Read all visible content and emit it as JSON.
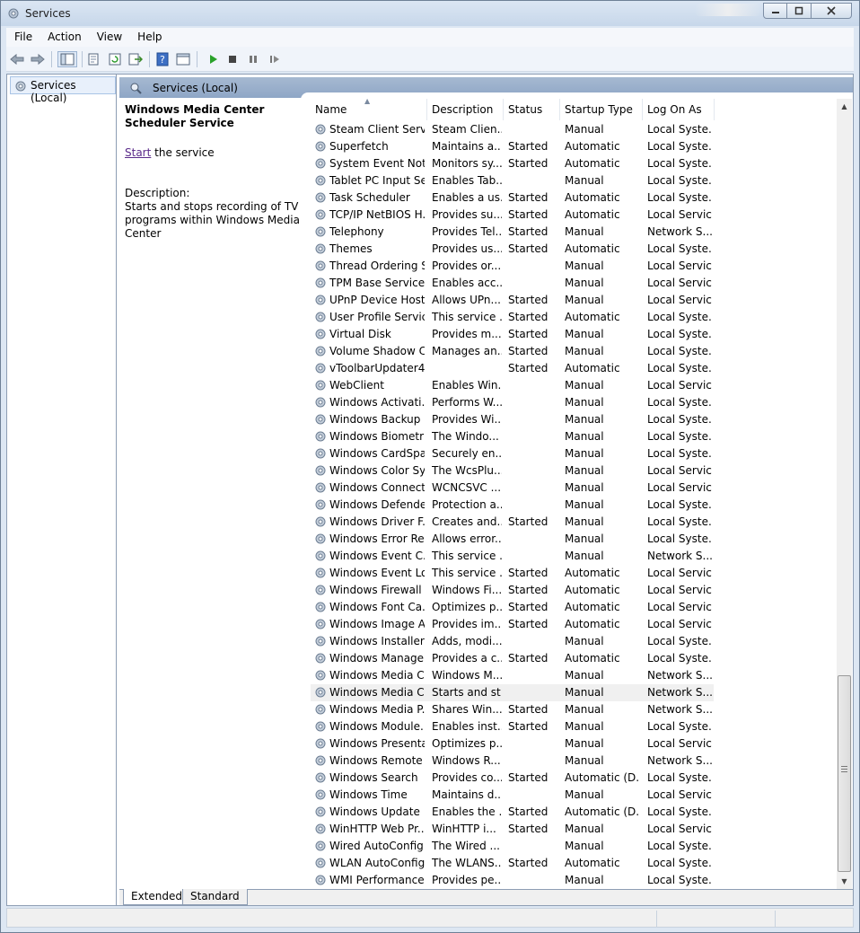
{
  "window": {
    "title": "Services"
  },
  "menu": [
    "File",
    "Action",
    "View",
    "Help"
  ],
  "tree": {
    "root_label": "Services (Local)"
  },
  "panel": {
    "header": "Services (Local)"
  },
  "detail": {
    "title": "Windows Media Center Scheduler Service",
    "start_link": "Start",
    "start_suffix": " the service",
    "description_label": "Description:",
    "description_text": "Starts and stops recording of TV programs within Windows Media Center"
  },
  "columns": {
    "name": "Name",
    "description": "Description",
    "status": "Status",
    "startup": "Startup Type",
    "logon": "Log On As"
  },
  "services": [
    [
      "Steam Client Servi...",
      "Steam Clien...",
      "",
      "Manual",
      "Local Syste..."
    ],
    [
      "Superfetch",
      "Maintains a...",
      "Started",
      "Automatic",
      "Local Syste..."
    ],
    [
      "System Event Noti...",
      "Monitors sy...",
      "Started",
      "Automatic",
      "Local Syste..."
    ],
    [
      "Tablet PC Input Se...",
      "Enables Tab...",
      "",
      "Manual",
      "Local Syste..."
    ],
    [
      "Task Scheduler",
      "Enables a us...",
      "Started",
      "Automatic",
      "Local Syste..."
    ],
    [
      "TCP/IP NetBIOS H...",
      "Provides su...",
      "Started",
      "Automatic",
      "Local Service"
    ],
    [
      "Telephony",
      "Provides Tel...",
      "Started",
      "Manual",
      "Network S..."
    ],
    [
      "Themes",
      "Provides us...",
      "Started",
      "Automatic",
      "Local Syste..."
    ],
    [
      "Thread Ordering S...",
      "Provides or...",
      "",
      "Manual",
      "Local Service"
    ],
    [
      "TPM Base Services",
      "Enables acc...",
      "",
      "Manual",
      "Local Service"
    ],
    [
      "UPnP Device Host",
      "Allows UPn...",
      "Started",
      "Manual",
      "Local Service"
    ],
    [
      "User Profile Service",
      "This service ...",
      "Started",
      "Automatic",
      "Local Syste..."
    ],
    [
      "Virtual Disk",
      "Provides m...",
      "Started",
      "Manual",
      "Local Syste..."
    ],
    [
      "Volume Shadow C...",
      "Manages an...",
      "Started",
      "Manual",
      "Local Syste..."
    ],
    [
      "vToolbarUpdater4...",
      "",
      "Started",
      "Automatic",
      "Local Syste..."
    ],
    [
      "WebClient",
      "Enables Win...",
      "",
      "Manual",
      "Local Service"
    ],
    [
      "Windows Activati...",
      "Performs W...",
      "",
      "Manual",
      "Local Syste..."
    ],
    [
      "Windows Backup",
      "Provides Wi...",
      "",
      "Manual",
      "Local Syste..."
    ],
    [
      "Windows Biometri...",
      "The Windo...",
      "",
      "Manual",
      "Local Syste..."
    ],
    [
      "Windows CardSpa...",
      "Securely en...",
      "",
      "Manual",
      "Local Syste..."
    ],
    [
      "Windows Color Sy...",
      "The WcsPlu...",
      "",
      "Manual",
      "Local Service"
    ],
    [
      "Windows Connect...",
      "WCNCSVC ...",
      "",
      "Manual",
      "Local Service"
    ],
    [
      "Windows Defender",
      "Protection a...",
      "",
      "Manual",
      "Local Syste..."
    ],
    [
      "Windows Driver F...",
      "Creates and...",
      "Started",
      "Manual",
      "Local Syste..."
    ],
    [
      "Windows Error Re...",
      "Allows error...",
      "",
      "Manual",
      "Local Syste..."
    ],
    [
      "Windows Event C...",
      "This service ...",
      "",
      "Manual",
      "Network S..."
    ],
    [
      "Windows Event Log",
      "This service ...",
      "Started",
      "Automatic",
      "Local Service"
    ],
    [
      "Windows Firewall",
      "Windows Fi...",
      "Started",
      "Automatic",
      "Local Service"
    ],
    [
      "Windows Font Ca...",
      "Optimizes p...",
      "Started",
      "Automatic",
      "Local Service"
    ],
    [
      "Windows Image A...",
      "Provides im...",
      "Started",
      "Automatic",
      "Local Service"
    ],
    [
      "Windows Installer",
      "Adds, modi...",
      "",
      "Manual",
      "Local Syste..."
    ],
    [
      "Windows Manage...",
      "Provides a c...",
      "Started",
      "Automatic",
      "Local Syste..."
    ],
    [
      "Windows Media C...",
      "Windows M...",
      "",
      "Manual",
      "Network S..."
    ],
    [
      "Windows Media C...",
      "Starts and st...",
      "",
      "Manual",
      "Network S..."
    ],
    [
      "Windows Media P...",
      "Shares Win...",
      "Started",
      "Manual",
      "Network S..."
    ],
    [
      "Windows Module...",
      "Enables inst...",
      "Started",
      "Manual",
      "Local Syste..."
    ],
    [
      "Windows Presenta...",
      "Optimizes p...",
      "",
      "Manual",
      "Local Service"
    ],
    [
      "Windows Remote ...",
      "Windows R...",
      "",
      "Manual",
      "Network S..."
    ],
    [
      "Windows Search",
      "Provides co...",
      "Started",
      "Automatic (D...",
      "Local Syste..."
    ],
    [
      "Windows Time",
      "Maintains d...",
      "",
      "Manual",
      "Local Service"
    ],
    [
      "Windows Update",
      "Enables the ...",
      "Started",
      "Automatic (D...",
      "Local Syste..."
    ],
    [
      "WinHTTP Web Pr...",
      "WinHTTP i...",
      "Started",
      "Manual",
      "Local Service"
    ],
    [
      "Wired AutoConfig",
      "The Wired ...",
      "",
      "Manual",
      "Local Syste..."
    ],
    [
      "WLAN AutoConfig",
      "The WLANS...",
      "Started",
      "Automatic",
      "Local Syste..."
    ],
    [
      "WMI Performance...",
      "Provides pe...",
      "",
      "Manual",
      "Local Syste..."
    ]
  ],
  "selected_index": 33,
  "tabs": [
    "Extended",
    "Standard"
  ],
  "active_tab": "Extended",
  "colors": {
    "header_bar": "#9aafcc",
    "link": "#5a2a8a",
    "play": "#2aa22a"
  }
}
